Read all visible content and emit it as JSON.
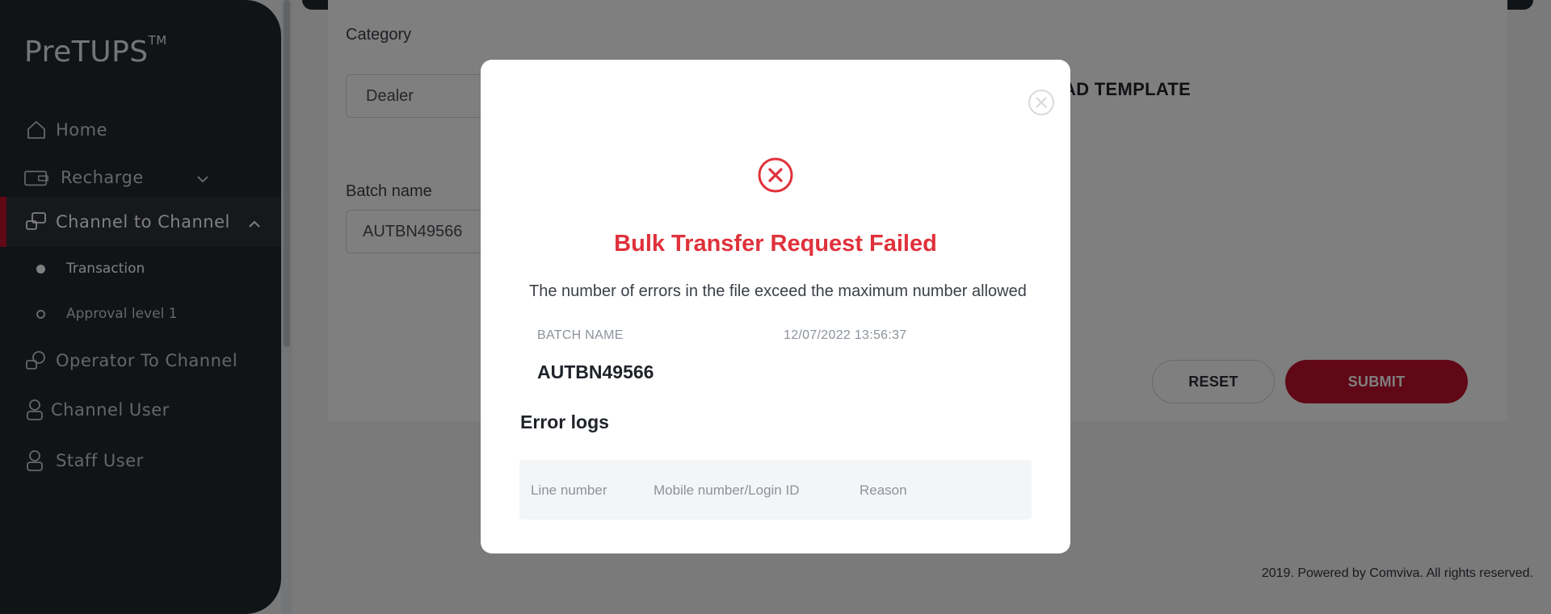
{
  "app": {
    "logo": "PreTUPS",
    "logo_tm": "TM"
  },
  "sidebar": {
    "items": [
      {
        "label": "Home",
        "icon": "home-icon"
      },
      {
        "label": "Recharge",
        "icon": "wallet-icon"
      },
      {
        "label": "Channel to Channel",
        "icon": "transfer-icon"
      },
      {
        "label": "Operator To Channel",
        "icon": "operator-icon"
      },
      {
        "label": "Channel User",
        "icon": "user-icon"
      },
      {
        "label": "Staff User",
        "icon": "user-icon"
      }
    ],
    "subitems": [
      {
        "label": "Transaction",
        "selected": true
      },
      {
        "label": "Approval level 1",
        "selected": false
      }
    ]
  },
  "form": {
    "category_label": "Category",
    "category_value": "Dealer",
    "batch_label": "Batch name",
    "batch_value": "AUTBN49566",
    "download_template": "AD TEMPLATE",
    "reset": "RESET",
    "submit": "SUBMIT"
  },
  "footer": "2019. Powered by Comviva. All rights reserved.",
  "modal": {
    "title": "Bulk Transfer Request Failed",
    "message": "The number of errors in the file exceed the maximum number allowed",
    "batch_name_label": "BATCH NAME",
    "timestamp": "12/07/2022 13:56:37",
    "batch_name_value": "AUTBN49566",
    "error_logs_title": "Error logs",
    "columns": [
      "Line number",
      "Mobile number/Login ID",
      "Reason"
    ]
  },
  "colors": {
    "brand": "#c0102c",
    "error": "#e0313b",
    "sidebar": "#23282f"
  }
}
